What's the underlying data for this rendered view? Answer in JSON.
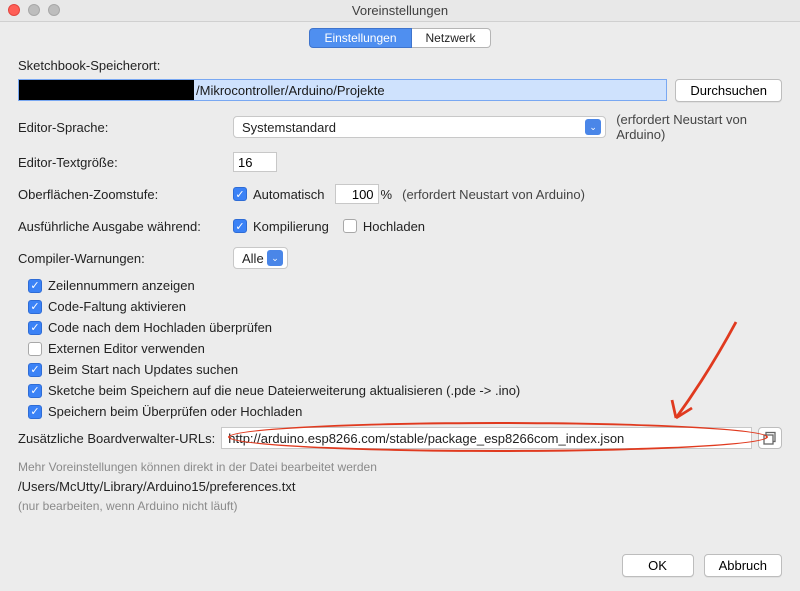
{
  "window": {
    "title": "Voreinstellungen"
  },
  "tabs": {
    "settings": "Einstellungen",
    "network": "Netzwerk"
  },
  "sketchbook": {
    "label": "Sketchbook-Speicherort:",
    "value_visible": "/Mikrocontroller/Arduino/Projekte",
    "browse": "Durchsuchen"
  },
  "language": {
    "label": "Editor-Sprache:",
    "value": "Systemstandard",
    "note": "(erfordert Neustart von Arduino)"
  },
  "fontsize": {
    "label": "Editor-Textgröße:",
    "value": "16"
  },
  "zoom": {
    "label": "Oberflächen-Zoomstufe:",
    "auto_label": "Automatisch",
    "percent": "100",
    "percent_suffix": "%",
    "note": "(erfordert Neustart von Arduino)"
  },
  "verbose": {
    "label": "Ausführliche Ausgabe während:",
    "compile": "Kompilierung",
    "upload": "Hochladen"
  },
  "warnings": {
    "label": "Compiler-Warnungen:",
    "value": "Alle"
  },
  "checkboxes": {
    "line_numbers": "Zeilennummern anzeigen",
    "code_folding": "Code-Faltung aktivieren",
    "verify_after_upload": "Code nach dem Hochladen überprüfen",
    "external_editor": "Externen Editor verwenden",
    "check_updates": "Beim Start nach Updates suchen",
    "update_extension": "Sketche beim Speichern auf die neue Dateierweiterung aktualisieren (.pde -> .ino)",
    "save_on_verify": "Speichern beim Überprüfen oder Hochladen"
  },
  "board_urls": {
    "label": "Zusätzliche Boardverwalter-URLs:",
    "value": "http://arduino.esp8266.com/stable/package_esp8266com_index.json"
  },
  "footer": {
    "more": "Mehr Voreinstellungen können direkt in der Datei bearbeitet werden",
    "path": "/Users/McUtty/Library/Arduino15/preferences.txt",
    "note": "(nur bearbeiten, wenn Arduino nicht läuft)"
  },
  "buttons": {
    "ok": "OK",
    "cancel": "Abbruch"
  }
}
